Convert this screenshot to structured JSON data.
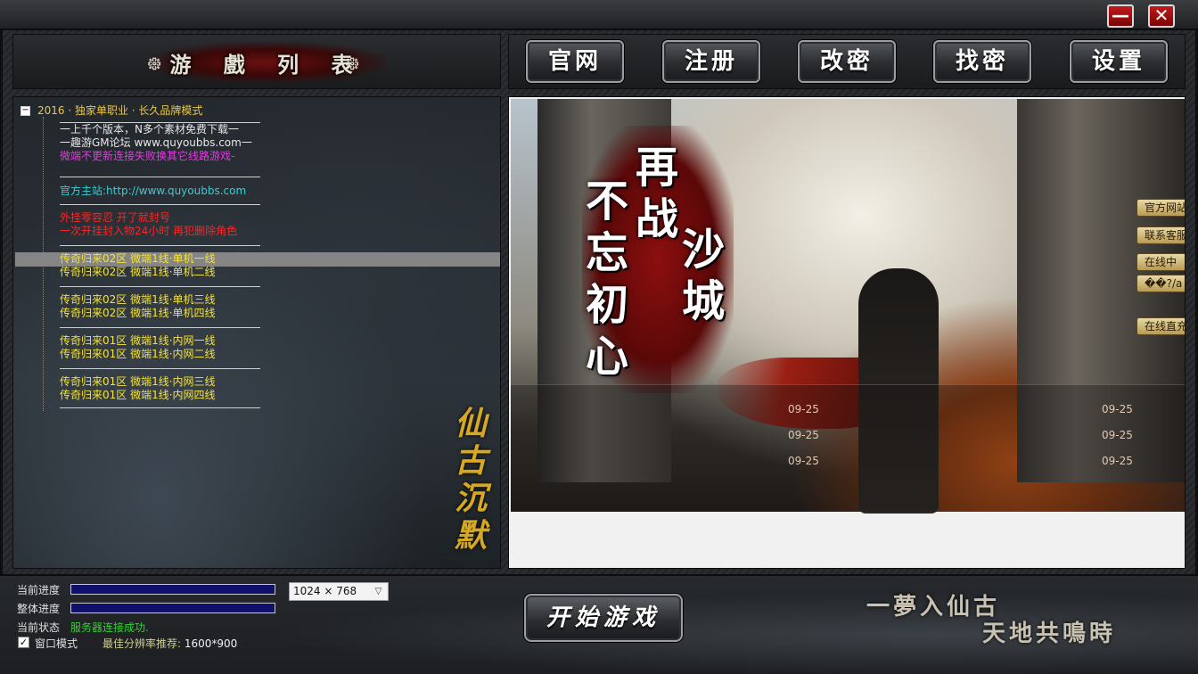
{
  "window": {
    "minimize_label": "—",
    "close_label": "✕"
  },
  "server_list": {
    "title": "游 戲 列 表",
    "ornament": "᪥",
    "root_label": "2016 · 独家单职业 · 长久品牌模式",
    "root_toggle": "−",
    "groups": [
      {
        "lines": [
          {
            "text": "一上千个版本，N多个素材免费下载一",
            "color": "white"
          },
          {
            "text": "一趣游GM论坛   www.quyoubbs.com一",
            "color": "white"
          },
          {
            "text": "微端不更新连接失败换其它线路游戏-",
            "color": "magenta"
          }
        ]
      },
      {
        "lines": [
          {
            "text": "官方主站:http://www.quyoubbs.com",
            "color": "cyan"
          }
        ]
      },
      {
        "lines": [
          {
            "text": "       外挂零容忍  开了就封号",
            "color": "red"
          },
          {
            "text": "一次开挂封入物24小时 再犯删除角色",
            "color": "red"
          }
        ]
      },
      {
        "lines": [
          {
            "text": "传奇归来02区   微端1线·单机一线",
            "color": "yellow"
          },
          {
            "text": "传奇归来02区   微端1线·单机二线",
            "color": "yellow"
          }
        ]
      },
      {
        "lines": [
          {
            "text": "传奇归来02区   微端1线·单机三线",
            "color": "yellow"
          },
          {
            "text": "传奇归来02区   微端1线·单机四线",
            "color": "yellow"
          }
        ]
      },
      {
        "lines": [
          {
            "text": "传奇归来01区   微端1线·内网一线",
            "color": "yellow"
          },
          {
            "text": "传奇归来01区   微端1线·内网二线",
            "color": "yellow"
          }
        ]
      },
      {
        "lines": [
          {
            "text": "传奇归来01区   微端1线·内网三线",
            "color": "yellow"
          },
          {
            "text": "传奇归来01区   微端1线·内网四线",
            "color": "yellow"
          }
        ]
      }
    ],
    "calligraphy": "仙古沉默"
  },
  "nav": {
    "official": "官网",
    "register": "注册",
    "change_pw": "改密",
    "find_pw": "找密",
    "settings": "设置"
  },
  "news": {
    "slogan_col1": "不忘初心",
    "slogan_col2": "再战",
    "slogan_col3": "沙城",
    "side_links": [
      "官方网站",
      "联系客服",
      "在线中",
      "��?/a",
      "在线直充"
    ],
    "dates_left": [
      "09-25",
      "09-25",
      "09-25"
    ],
    "dates_right": [
      "09-25",
      "09-25",
      "09-25"
    ]
  },
  "bottom": {
    "current_progress_label": "当前进度",
    "total_progress_label": "整体进度",
    "status_label": "当前状态",
    "status_value": "服务器连接成功.",
    "window_mode_label": "窗口模式",
    "window_mode_checked": "✓",
    "res_tip_label": "最佳分辨率推荐:",
    "res_tip_value": "1600*900",
    "resolution": "1024 × 768",
    "res_arrow": "▽",
    "start_button": "开始游戏",
    "poem_line1": "一夢入仙古",
    "poem_line2": "天地共鳴時",
    "colors": {
      "progress": "#1a1ac8",
      "status_ok": "#2fd62f",
      "accent_red": "#c01a1a"
    }
  }
}
